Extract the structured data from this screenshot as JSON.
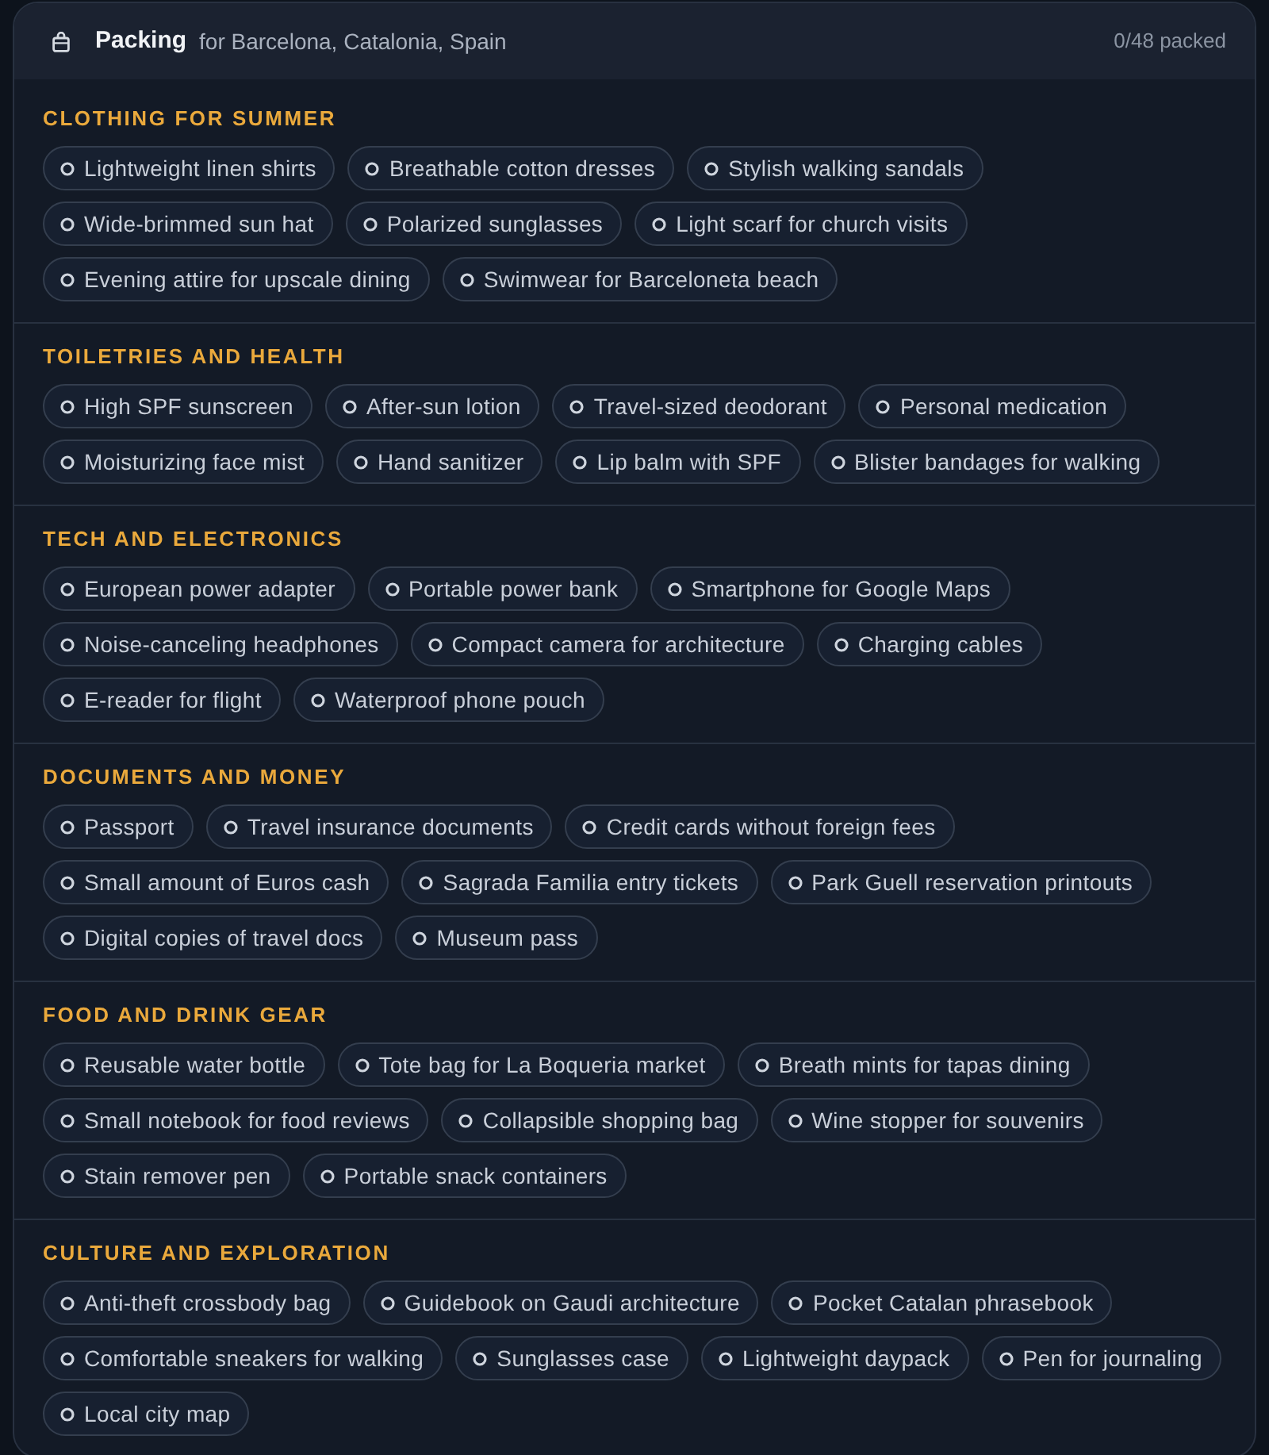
{
  "header": {
    "title": "Packing",
    "subtitle": "for Barcelona, Catalonia, Spain",
    "progress": "0/48 packed"
  },
  "sections": [
    {
      "title": "CLOTHING FOR SUMMER",
      "items": [
        {
          "label": "Lightweight linen shirts",
          "packed": false
        },
        {
          "label": "Breathable cotton dresses",
          "packed": false
        },
        {
          "label": "Stylish walking sandals",
          "packed": false
        },
        {
          "label": "Wide-brimmed sun hat",
          "packed": false
        },
        {
          "label": "Polarized sunglasses",
          "packed": false
        },
        {
          "label": "Light scarf for church visits",
          "packed": false
        },
        {
          "label": "Evening attire for upscale dining",
          "packed": false
        },
        {
          "label": "Swimwear for Barceloneta beach",
          "packed": false
        }
      ]
    },
    {
      "title": "TOILETRIES AND HEALTH",
      "items": [
        {
          "label": "High SPF sunscreen",
          "packed": false
        },
        {
          "label": "After-sun lotion",
          "packed": false
        },
        {
          "label": "Travel-sized deodorant",
          "packed": false
        },
        {
          "label": "Personal medication",
          "packed": false
        },
        {
          "label": "Moisturizing face mist",
          "packed": false
        },
        {
          "label": "Hand sanitizer",
          "packed": false
        },
        {
          "label": "Lip balm with SPF",
          "packed": false
        },
        {
          "label": "Blister bandages for walking",
          "packed": false
        }
      ]
    },
    {
      "title": "TECH AND ELECTRONICS",
      "items": [
        {
          "label": "European power adapter",
          "packed": false
        },
        {
          "label": "Portable power bank",
          "packed": false
        },
        {
          "label": "Smartphone for Google Maps",
          "packed": false
        },
        {
          "label": "Noise-canceling headphones",
          "packed": false
        },
        {
          "label": "Compact camera for architecture",
          "packed": false
        },
        {
          "label": "Charging cables",
          "packed": false
        },
        {
          "label": "E-reader for flight",
          "packed": false
        },
        {
          "label": "Waterproof phone pouch",
          "packed": false
        }
      ]
    },
    {
      "title": "DOCUMENTS AND MONEY",
      "items": [
        {
          "label": "Passport",
          "packed": false
        },
        {
          "label": "Travel insurance documents",
          "packed": false
        },
        {
          "label": "Credit cards without foreign fees",
          "packed": false
        },
        {
          "label": "Small amount of Euros cash",
          "packed": false
        },
        {
          "label": "Sagrada Familia entry tickets",
          "packed": false
        },
        {
          "label": "Park Guell reservation printouts",
          "packed": false
        },
        {
          "label": "Digital copies of travel docs",
          "packed": false
        },
        {
          "label": "Museum pass",
          "packed": false
        }
      ]
    },
    {
      "title": "FOOD AND DRINK GEAR",
      "items": [
        {
          "label": "Reusable water bottle",
          "packed": false
        },
        {
          "label": "Tote bag for La Boqueria market",
          "packed": false
        },
        {
          "label": "Breath mints for tapas dining",
          "packed": false
        },
        {
          "label": "Small notebook for food reviews",
          "packed": false
        },
        {
          "label": "Collapsible shopping bag",
          "packed": false
        },
        {
          "label": "Wine stopper for souvenirs",
          "packed": false
        },
        {
          "label": "Stain remover pen",
          "packed": false
        },
        {
          "label": "Portable snack containers",
          "packed": false
        }
      ]
    },
    {
      "title": "CULTURE AND EXPLORATION",
      "items": [
        {
          "label": "Anti-theft crossbody bag",
          "packed": false
        },
        {
          "label": "Guidebook on Gaudi architecture",
          "packed": false
        },
        {
          "label": "Pocket Catalan phrasebook",
          "packed": false
        },
        {
          "label": "Comfortable sneakers for walking",
          "packed": false
        },
        {
          "label": "Sunglasses case",
          "packed": false
        },
        {
          "label": "Lightweight daypack",
          "packed": false
        },
        {
          "label": "Pen for journaling",
          "packed": false
        },
        {
          "label": "Local city map",
          "packed": false
        }
      ]
    }
  ]
}
